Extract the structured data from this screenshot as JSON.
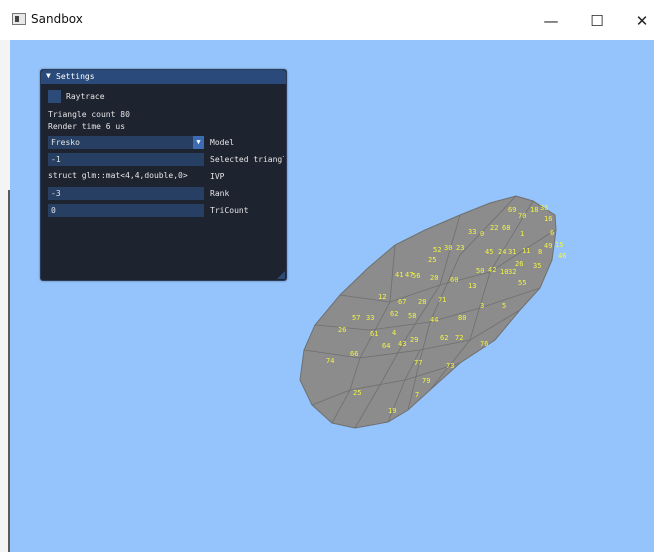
{
  "window": {
    "title": "Sandbox",
    "icon": "app-window-icon",
    "controls": {
      "minimize": "—",
      "maximize": "☐",
      "close": "✕"
    }
  },
  "colors": {
    "viewport_background": "#94c4fb",
    "mesh_fill": "#8c8c8c",
    "mesh_edge": "#6f6f6f",
    "label_color": "#f2f542",
    "panel_background": "#1e2330",
    "panel_header": "#294a7a"
  },
  "settings": {
    "title": "Settings",
    "collapse_icon": "▼",
    "raytrace_label": "Raytrace",
    "raytrace_checked": false,
    "triangle_count_text": "Triangle count 80",
    "render_time_text": "Render time    6 us",
    "model": {
      "value": "Fresko",
      "label": "Model",
      "arrow": "▼"
    },
    "selected_triangle": {
      "value": "-1",
      "label": "Selected triangle"
    },
    "ivp": {
      "value": "struct glm::mat<4,4,double,0>",
      "label": "IVP"
    },
    "rank": {
      "value": "-3",
      "label": "Rank"
    },
    "tricount": {
      "value": "0",
      "label": "TriCount"
    }
  },
  "mesh_labels": [
    "69",
    "70",
    "18",
    "36",
    "16",
    "6",
    "15",
    "46",
    "49",
    "8",
    "1",
    "33",
    "0",
    "22",
    "68",
    "45",
    "24",
    "31",
    "26",
    "11",
    "35",
    "52",
    "30",
    "23",
    "25",
    "50",
    "42",
    "10",
    "32",
    "55",
    "56",
    "41",
    "47",
    "20",
    "60",
    "13",
    "12",
    "67",
    "28",
    "71",
    "62",
    "58",
    "44",
    "80",
    "3",
    "5",
    "57",
    "33",
    "26",
    "61",
    "4",
    "29",
    "62",
    "72",
    "76",
    "74",
    "66",
    "64",
    "43",
    "77",
    "73",
    "79",
    "7",
    "25",
    "19"
  ]
}
